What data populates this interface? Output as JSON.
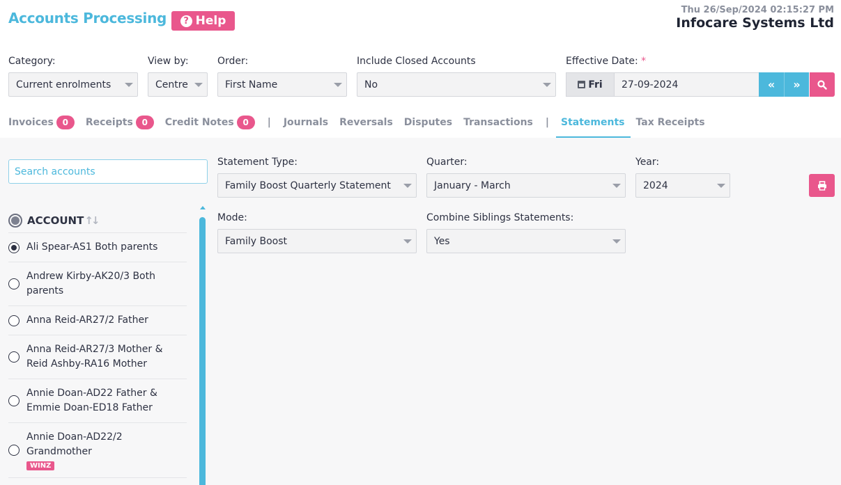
{
  "header": {
    "title": "Accounts Processing",
    "help_label": "Help",
    "datetime": "Thu 26/Sep/2024 02:15:27 PM",
    "company": "Infocare Systems Ltd"
  },
  "filters": {
    "category": {
      "label": "Category:",
      "value": "Current enrolments"
    },
    "view_by": {
      "label": "View by:",
      "value": "Centre"
    },
    "order": {
      "label": "Order:",
      "value": "First Name"
    },
    "closed": {
      "label": "Include Closed Accounts",
      "value": "No"
    },
    "effective_date": {
      "label": "Effective Date:",
      "required_mark": "*",
      "day": "Fri",
      "value": "27-09-2024"
    }
  },
  "tabs": [
    {
      "label": "Invoices",
      "badge": "0"
    },
    {
      "label": "Receipts",
      "badge": "0"
    },
    {
      "label": "Credit Notes",
      "badge": "0"
    },
    {
      "label": "Journals"
    },
    {
      "label": "Reversals"
    },
    {
      "label": "Disputes"
    },
    {
      "label": "Transactions"
    },
    {
      "label": "Statements",
      "active": true
    },
    {
      "label": "Tax Receipts"
    }
  ],
  "separator": "|",
  "accounts": {
    "search_placeholder": "Search accounts",
    "header": "ACCOUNT",
    "items": [
      {
        "name": "Ali Spear-AS1 Both parents",
        "checked": true
      },
      {
        "name": "Andrew Kirby-AK20/3 Both parents"
      },
      {
        "name": "Anna Reid-AR27/2 Father"
      },
      {
        "name": "Anna Reid-AR27/3 Mother & Reid Ashby-RA16 Mother"
      },
      {
        "name": "Annie Doan-AD22 Father & Emmie Doan-ED18 Father"
      },
      {
        "name": "Annie Doan-AD22/2 Grandmother",
        "tag": "WINZ"
      }
    ]
  },
  "statement": {
    "type": {
      "label": "Statement Type:",
      "value": "Family Boost Quarterly Statement"
    },
    "quarter": {
      "label": "Quarter:",
      "value": "January - March"
    },
    "year": {
      "label": "Year:",
      "value": "2024"
    },
    "mode": {
      "label": "Mode:",
      "value": "Family Boost"
    },
    "combine": {
      "label": "Combine Siblings Statements:",
      "value": "Yes"
    }
  },
  "colors": {
    "accent": "#4cb8dc",
    "pink": "#e9578c"
  },
  "icons": [
    "question-circle-icon",
    "calendar-icon",
    "double-left-icon",
    "double-right-icon",
    "search-icon",
    "sort-icon",
    "print-icon"
  ]
}
